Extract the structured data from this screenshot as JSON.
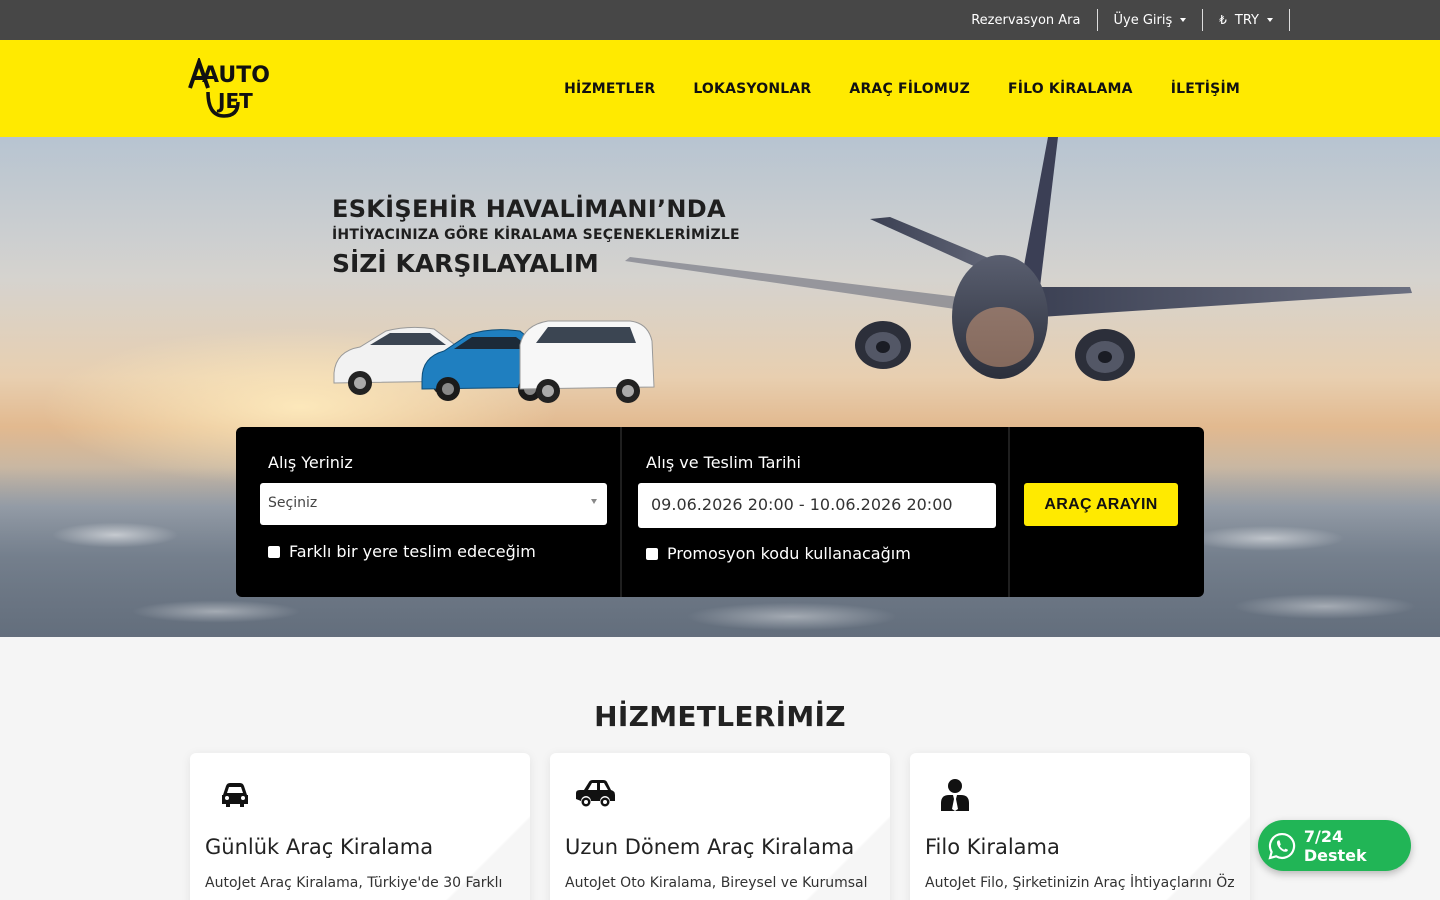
{
  "topbar": {
    "reservation_search": "Rezervasyon Ara",
    "member_login": "Üye Giriş",
    "currency_symbol": "₺",
    "currency": "TRY"
  },
  "logo": {
    "text_top": "AUTO",
    "text_bottom": "JET"
  },
  "nav": [
    {
      "label": "HİZMETLER"
    },
    {
      "label": "LOKASYONLAR"
    },
    {
      "label": "ARAÇ FİLOMUZ"
    },
    {
      "label": "FİLO KİRALAMA"
    },
    {
      "label": "İLETİŞİM"
    }
  ],
  "hero": {
    "line1": "ESKİŞEHİR HAVALİMANI’NDA",
    "line2": "İHTİYACINIZA GÖRE KİRALAMA SEÇENEKLERİMİZLE",
    "line3": "SİZİ KARŞILAYALIM"
  },
  "search": {
    "pickup_label": "Alış Yeriniz",
    "pickup_value": "Seçiniz",
    "different_dropoff": "Farklı bir yere teslim edeceğim",
    "dates_label": "Alış ve Teslim Tarihi",
    "dates_value": "09.06.2026 20:00 - 10.06.2026 20:00",
    "promo": "Promosyon kodu kullanacağım",
    "button": "ARAÇ ARAYIN"
  },
  "services": {
    "title": "HİZMETLERİMİZ",
    "cards": [
      {
        "icon": "car-front-icon",
        "title": "Günlük Araç Kiralama",
        "text": "AutoJet Araç Kiralama, Türkiye'de 30 Farklı"
      },
      {
        "icon": "car-side-icon",
        "title": "Uzun Dönem Araç Kiralama",
        "text": "AutoJet Oto Kiralama, Bireysel ve Kurumsal"
      },
      {
        "icon": "business-person-icon",
        "title": "Filo Kiralama",
        "text": "AutoJet Filo, Şirketinizin Araç İhtiyaçlarını Öz"
      }
    ]
  },
  "whatsapp": {
    "label": "7/24 Destek"
  },
  "colors": {
    "brand_yellow": "#ffea00",
    "topbar": "#474747",
    "whatsapp_green": "#21b556"
  }
}
